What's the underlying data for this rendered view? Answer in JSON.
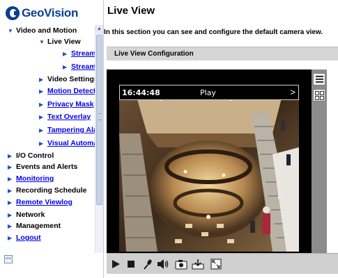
{
  "brand": {
    "name": "GeoVision"
  },
  "nav": {
    "items": [
      {
        "label": "Video and Motion",
        "level": 1,
        "expanded": true,
        "link": false
      },
      {
        "label": "Live View",
        "level": 2,
        "expanded": true,
        "link": false
      },
      {
        "label": "Streami",
        "level": 3,
        "link": true
      },
      {
        "label": "Streami",
        "level": 3,
        "link": true
      },
      {
        "label": "Video Settings",
        "level": 2,
        "link": false
      },
      {
        "label": "Motion Detecti",
        "level": 2,
        "link": true
      },
      {
        "label": "Privacy Mask",
        "level": 2,
        "link": true
      },
      {
        "label": "Text Overlay",
        "level": 2,
        "link": true
      },
      {
        "label": "Tampering Alar",
        "level": 2,
        "link": true
      },
      {
        "label": "Visual Automat",
        "level": 2,
        "link": true
      },
      {
        "label": "I/O Control",
        "level": 1,
        "link": false
      },
      {
        "label": "Events and Alerts",
        "level": 1,
        "link": false
      },
      {
        "label": "Monitoring",
        "level": 1,
        "link": true
      },
      {
        "label": "Recording Schedule",
        "level": 1,
        "link": false
      },
      {
        "label": "Remote Viewlog",
        "level": 1,
        "link": true
      },
      {
        "label": "Network",
        "level": 1,
        "link": false
      },
      {
        "label": "Management",
        "level": 1,
        "link": false
      },
      {
        "label": "Logout",
        "level": 1,
        "link": true
      }
    ],
    "collapse_label": "<<"
  },
  "content": {
    "title": "Live View",
    "intro": "In this section you can see and configure the default camera view.",
    "section_title": "Live View Configuration"
  },
  "player": {
    "time": "16:44:48",
    "state": "Play",
    "next_glyph": ">"
  },
  "toolbar": {
    "buttons": [
      "play",
      "stop",
      "microphone",
      "speaker",
      "snapshot",
      "record",
      "fullscreen"
    ]
  },
  "colors": {
    "brand": "#0b3e8f",
    "link": "#0000ee",
    "section_bar": "#d6d6d6",
    "toolbar": "#cfcfcf"
  }
}
